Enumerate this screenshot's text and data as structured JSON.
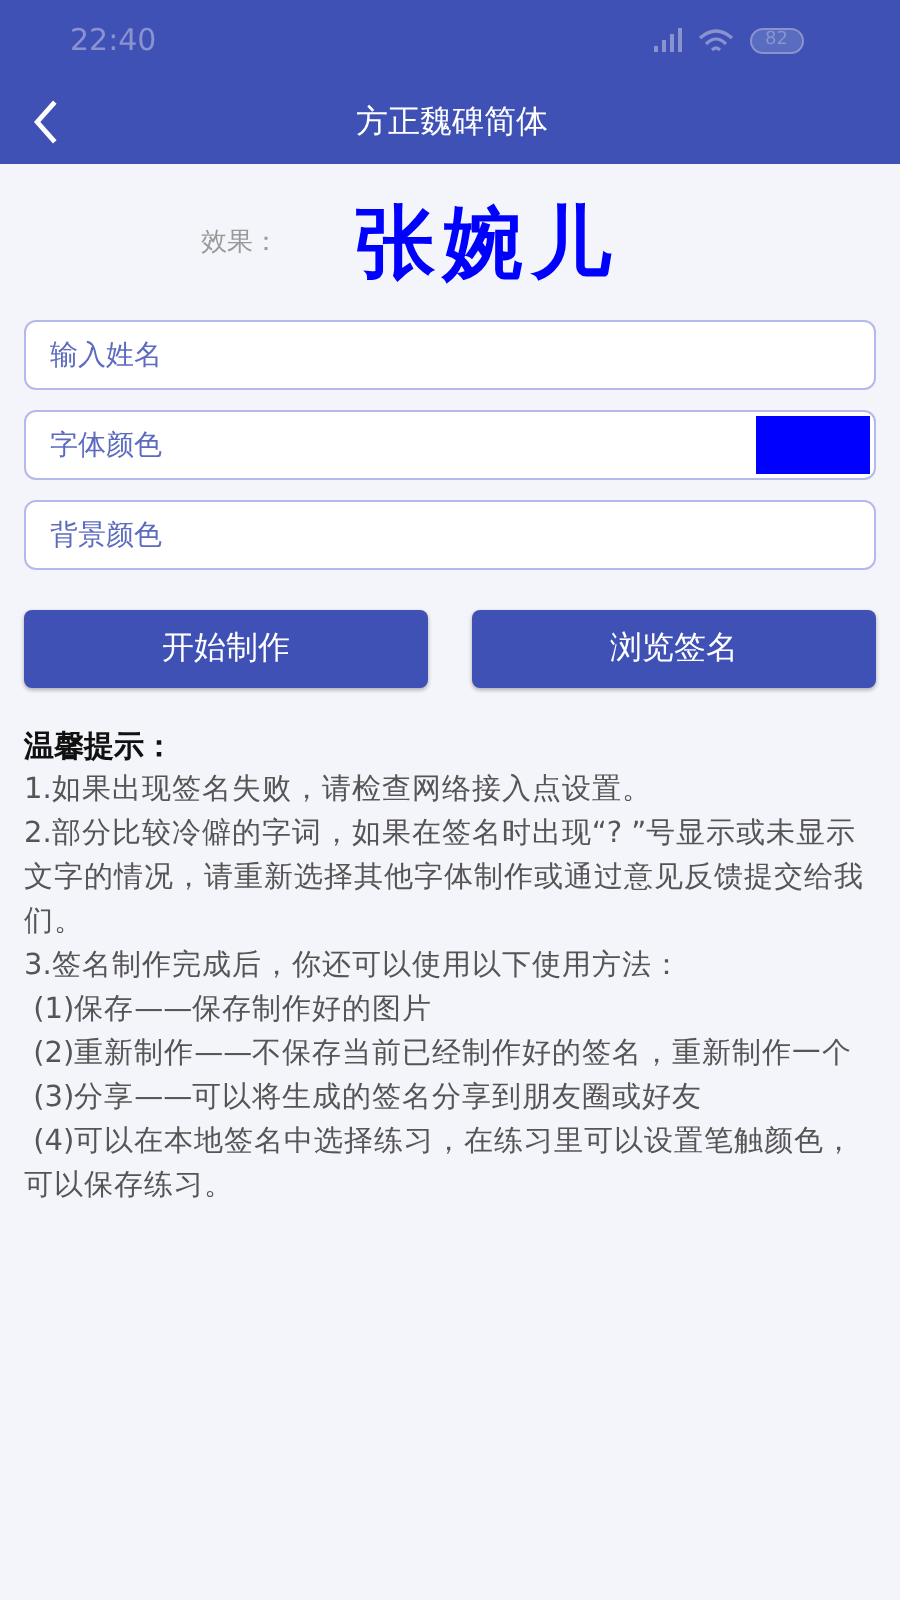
{
  "status_bar": {
    "time": "22:40",
    "battery": "82"
  },
  "header": {
    "title": "方正魏碑简体"
  },
  "preview": {
    "label": "效果：",
    "signature": "张婉儿"
  },
  "form": {
    "name_field": {
      "placeholder": "输入姓名"
    },
    "color_rows": [
      {
        "label": "字体颜色",
        "color": "#0000ff"
      },
      {
        "label": "背景颜色"
      }
    ]
  },
  "buttons": [
    "开始制作",
    "浏览签名"
  ],
  "tips": {
    "title": "温馨提示：",
    "lines": [
      "1.如果出现签名失败，请检查网络接入点设置。",
      "2.部分比较冷僻的字词，如果在签名时出现“? ”号显示或未显示文字的情况，请重新选择其他字体制作或通过意见反馈提交给我们。",
      "3.签名制作完成后，你还可以使用以下使用方法：",
      " (1)保存——保存制作好的图片",
      " (2)重新制作——不保存当前已经制作好的签名，重新制作一个",
      " (3)分享——可以将生成的签名分享到朋友圈或好友",
      " (4)可以在本地签名中选择练习，在练习里可以设置笔触颜色，可以保存练习。"
    ]
  }
}
